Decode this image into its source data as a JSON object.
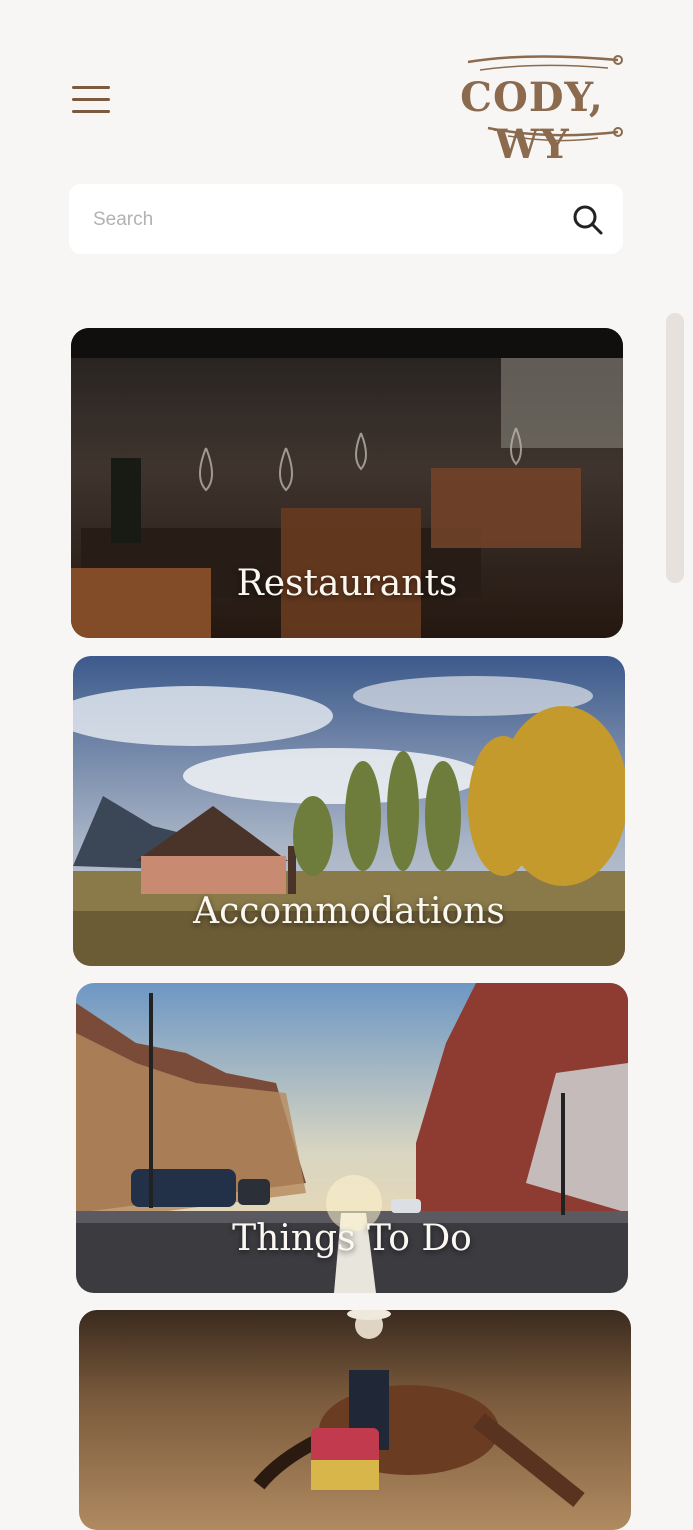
{
  "header": {
    "logo_text": "CODY, WY",
    "menu_icon": "hamburger-menu-icon"
  },
  "search": {
    "placeholder": "Search",
    "icon": "search-icon"
  },
  "categories": [
    {
      "label": "Restaurants"
    },
    {
      "label": "Accommodations"
    },
    {
      "label": "Things To Do"
    },
    {
      "label": ""
    }
  ],
  "colors": {
    "brand_brown": "#8b6a4e",
    "menu_brown": "#7b5a3e",
    "background": "#f7f6f5"
  }
}
